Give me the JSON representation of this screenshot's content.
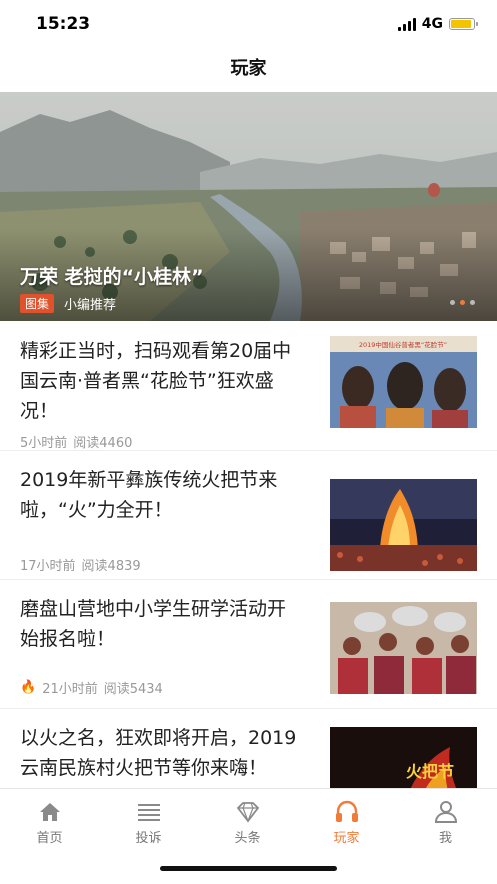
{
  "status": {
    "time": "15:23",
    "network": "4G"
  },
  "nav": {
    "title": "玩家"
  },
  "banner": {
    "title": "万荣 老挝的“小桂林”",
    "tag": "图集",
    "subtitle": "小编推荐"
  },
  "articles": [
    {
      "title": "精彩正当时，扫码观看第20届中国云南·普者黑“花脸节”狂欢盛况！",
      "time": "5小时前",
      "reads": "阅读4460",
      "hot": false,
      "thumb_text": "2019中国仙谷普者黑“花脸节”"
    },
    {
      "title": "2019年新平彝族传统火把节来啦，“火”力全开！",
      "time": "17小时前",
      "reads": "阅读4839",
      "hot": false
    },
    {
      "title": "磨盘山营地中小学生研学活动开始报名啦！",
      "time": "21小时前",
      "reads": "阅读5434",
      "hot": true
    },
    {
      "title": "以火之名，狂欢即将开启，2019云南民族村火把节等你来嗨！",
      "time": "",
      "reads": "",
      "hot": false,
      "thumb_text": "火把节"
    }
  ],
  "tabs": [
    {
      "label": "首页",
      "icon": "home-icon",
      "active": false
    },
    {
      "label": "投诉",
      "icon": "list-icon",
      "active": false
    },
    {
      "label": "头条",
      "icon": "diamond-icon",
      "active": false
    },
    {
      "label": "玩家",
      "icon": "headphones-icon",
      "active": true
    },
    {
      "label": "我",
      "icon": "user-icon",
      "active": false
    }
  ],
  "colors": {
    "accent": "#f07b3a",
    "tag": "#e0522b",
    "battery": "#f5c400"
  }
}
